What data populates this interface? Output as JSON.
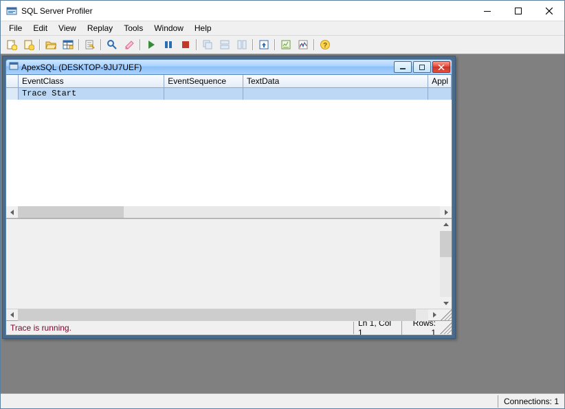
{
  "app": {
    "title": "SQL Server Profiler"
  },
  "menu": [
    "File",
    "Edit",
    "View",
    "Replay",
    "Tools",
    "Window",
    "Help"
  ],
  "child": {
    "title": "ApexSQL (DESKTOP-9JU7UEF)",
    "grid": {
      "columns": [
        "EventClass",
        "EventSequence",
        "TextData",
        "Appl"
      ],
      "rows": [
        {
          "EventClass": "Trace Start",
          "EventSequence": "",
          "TextData": "",
          "Appl": ""
        }
      ]
    },
    "status": {
      "message": "Trace is running.",
      "position": "Ln 1, Col 1",
      "rows": "Rows: 1"
    }
  },
  "status": {
    "connections": "Connections: 1"
  }
}
